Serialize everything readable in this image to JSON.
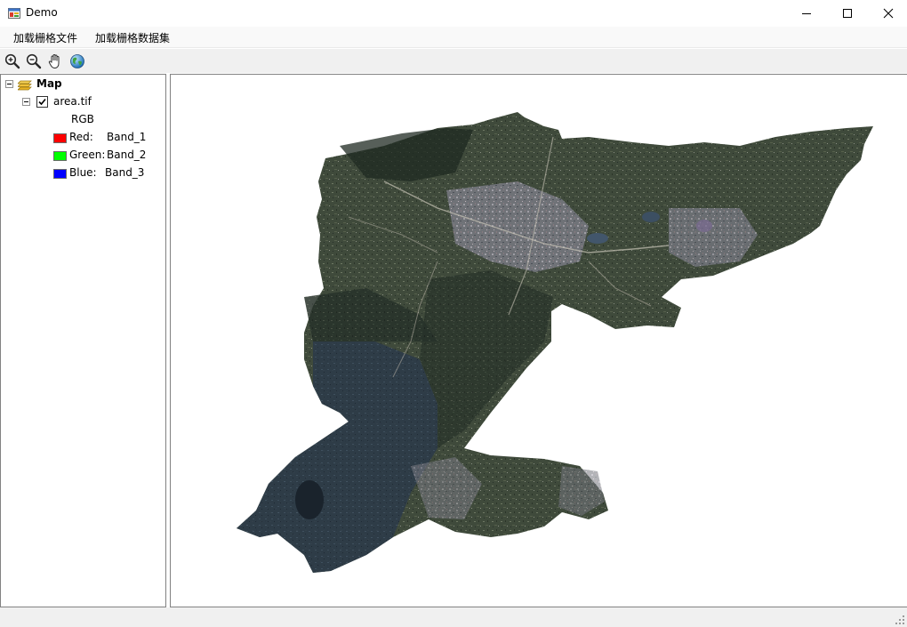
{
  "window": {
    "title": "Demo",
    "app_icon": "app-form-icon",
    "controls": [
      "minimize-icon",
      "maximize-icon",
      "close-icon"
    ]
  },
  "menu": {
    "items": [
      {
        "label": "加载栅格文件"
      },
      {
        "label": "加载栅格数据集"
      }
    ]
  },
  "toolbar": {
    "tools": [
      "zoom-in-icon",
      "zoom-out-icon",
      "pan-hand-icon",
      "full-extent-globe-icon"
    ]
  },
  "toc": {
    "root_label": "Map",
    "layer": {
      "name": "area.tif",
      "checked": true,
      "renderer_label": "RGB",
      "bands": [
        {
          "channel": "Red:",
          "band": "Band_1",
          "color": "#ff0000"
        },
        {
          "channel": "Green:",
          "band": "Band_2",
          "color": "#00ff00"
        },
        {
          "channel": "Blue:",
          "band": "Band_3",
          "color": "#0000ff"
        }
      ]
    }
  },
  "map": {
    "content": "satellite-raster-image",
    "background": "#ffffff"
  }
}
